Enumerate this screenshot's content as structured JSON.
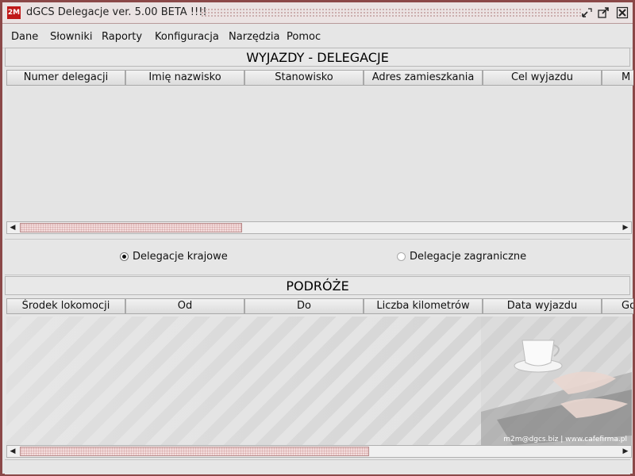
{
  "window": {
    "title": "dGCS Delegacje ver. 5.00 BETA !!!!",
    "icon_text": "2M"
  },
  "menu": [
    "Dane",
    "Słowniki",
    "Raporty",
    "Konfiguracja",
    "Narzędzia",
    "Pomoc"
  ],
  "trips": {
    "title": "WYJAZDY - DELEGACJE",
    "columns": [
      "Numer delegacji",
      "Imię nazwisko",
      "Stanowisko",
      "Adres zamieszkania",
      "Cel wyjazdu",
      "M"
    ]
  },
  "delegation_type": {
    "domestic_label": "Delegacje krajowe",
    "foreign_label": "Delegacje zagraniczne",
    "selected": "domestic"
  },
  "journeys": {
    "title": "PODRÓŻE",
    "columns": [
      "Środek lokomocji",
      "Od",
      "Do",
      "Liczba kilometrów",
      "Data wyjazdu",
      "Go"
    ]
  },
  "watermark": "m2m@dgcs.biz  |  www.cafefirma.pl",
  "colors": {
    "frame": "#8b4848",
    "accent": "#c01818",
    "scroll_thumb": "#f3dcdc"
  }
}
